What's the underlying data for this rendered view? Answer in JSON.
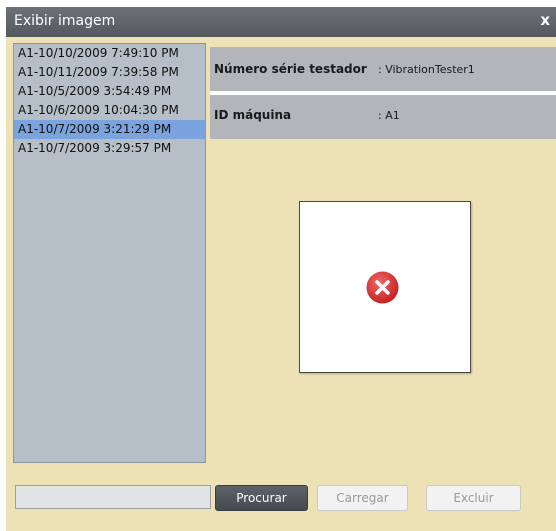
{
  "window": {
    "title": "Exibir imagem",
    "close_label": "x"
  },
  "image_list": {
    "items": [
      {
        "label": "A1-10/10/2009 7:49:10 PM",
        "selected": false
      },
      {
        "label": "A1-10/11/2009 7:39:58 PM",
        "selected": false
      },
      {
        "label": "A1-10/5/2009 3:54:49 PM",
        "selected": false
      },
      {
        "label": "A1-10/6/2009 10:04:30 PM",
        "selected": false
      },
      {
        "label": "A1-10/7/2009 3:21:29 PM",
        "selected": true
      },
      {
        "label": "A1-10/7/2009 3:29:57 PM",
        "selected": false
      }
    ]
  },
  "details": {
    "serial_label": "Número série testador",
    "serial_value": ": VibrationTester1",
    "machine_label": "ID máquina",
    "machine_value": ": A1"
  },
  "preview": {
    "icon": "error-icon",
    "icon_color": "#d93a3a"
  },
  "footer": {
    "path_value": "",
    "browse_label": "Procurar",
    "load_label": "Carregar",
    "delete_label": "Excluir"
  },
  "colors": {
    "background": "#ede2b6",
    "titlebar": "#5e636a",
    "list_background": "#b6bec7",
    "selection": "#7ba4de",
    "info_row": "#b3b5ba"
  }
}
